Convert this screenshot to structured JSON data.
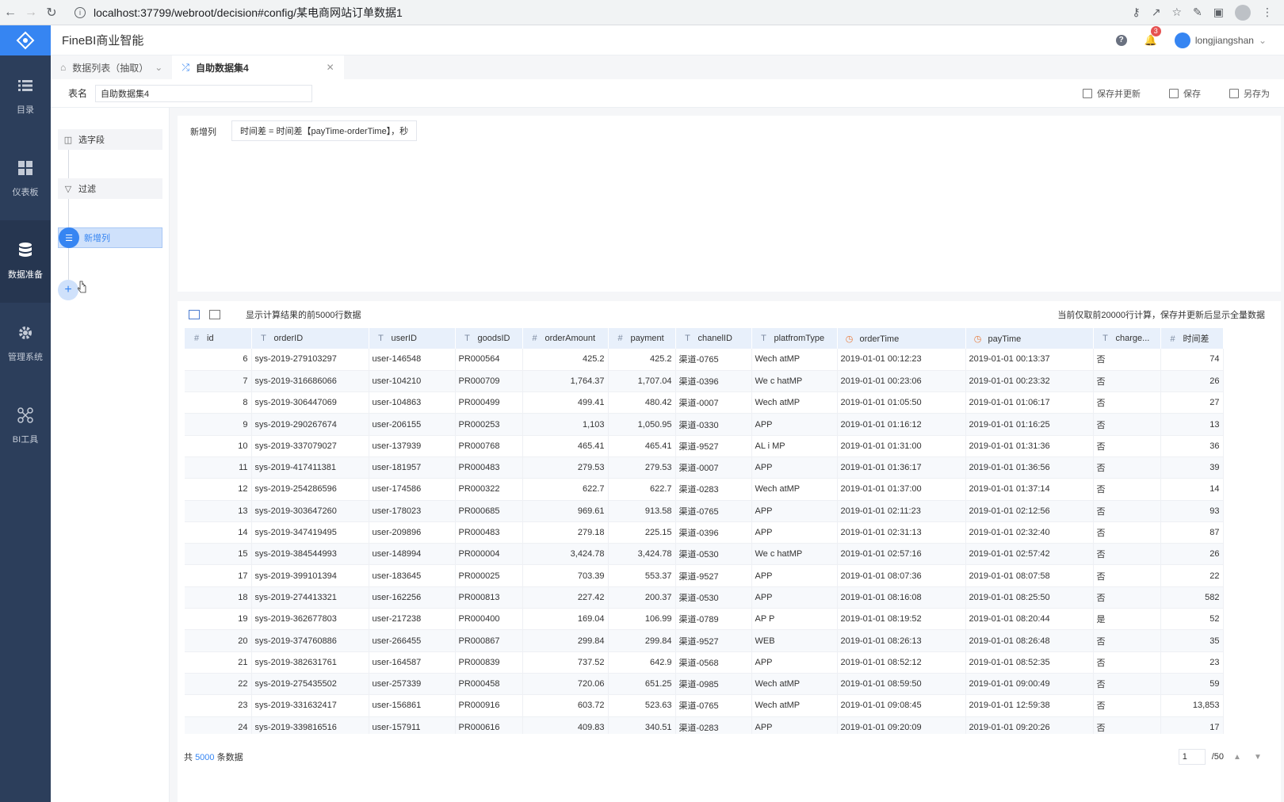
{
  "browser": {
    "url": "localhost:37799/webroot/decision#config/某电商网站订单数据1"
  },
  "sidebar": {
    "items": [
      {
        "label": "目录",
        "icon": "list-icon"
      },
      {
        "label": "仪表板",
        "icon": "dashboard-icon"
      },
      {
        "label": "数据准备",
        "icon": "database-icon",
        "active": true
      },
      {
        "label": "管理系统",
        "icon": "gear-icon"
      },
      {
        "label": "BI工具",
        "icon": "tools-icon"
      }
    ]
  },
  "header": {
    "title": "FineBI商业智能",
    "notification_count": "3",
    "username": "longjiangshan"
  },
  "tabs": [
    {
      "label": "数据列表（抽取）"
    },
    {
      "label": "自助数据集4",
      "active": true
    }
  ],
  "table_name": {
    "label": "表名",
    "value": "自助数据集4"
  },
  "actions": {
    "save_update": "保存并更新",
    "save": "保存",
    "save_as": "另存为"
  },
  "steps": [
    {
      "label": "选字段"
    },
    {
      "label": "过滤"
    },
    {
      "label": "新增列",
      "active": true
    }
  ],
  "config": {
    "label": "新增列",
    "formula": "时间差 = 时间差【payTime-orderTime】，秒"
  },
  "preview": {
    "tip": "显示计算结果的前5000行数据",
    "note": "当前仅取前20000行计算，保存并更新后显示全量数据",
    "columns": [
      {
        "type": "#",
        "name": "id"
      },
      {
        "type": "T",
        "name": "orderID"
      },
      {
        "type": "T",
        "name": "userID"
      },
      {
        "type": "T",
        "name": "goodsID"
      },
      {
        "type": "#",
        "name": "orderAmount"
      },
      {
        "type": "#",
        "name": "payment"
      },
      {
        "type": "T",
        "name": "chanelID"
      },
      {
        "type": "T",
        "name": "platfromType"
      },
      {
        "type": "clock",
        "name": "orderTime"
      },
      {
        "type": "clock",
        "name": "payTime"
      },
      {
        "type": "T",
        "name": "charge..."
      },
      {
        "type": "#",
        "name": "时间差"
      }
    ],
    "rows": [
      [
        "6",
        "sys-2019-279103297",
        "user-146548",
        "PR000564",
        "425.2",
        "425.2",
        "渠道-0765",
        "Wech atMP",
        "2019-01-01 00:12:23",
        "2019-01-01 00:13:37",
        "否",
        "74"
      ],
      [
        "7",
        "sys-2019-316686066",
        "user-104210",
        "PR000709",
        "1,764.37",
        "1,707.04",
        "渠道-0396",
        "We c hatMP",
        "2019-01-01 00:23:06",
        "2019-01-01 00:23:32",
        "否",
        "26"
      ],
      [
        "8",
        "sys-2019-306447069",
        "user-104863",
        "PR000499",
        "499.41",
        "480.42",
        "渠道-0007",
        "Wech atMP",
        "2019-01-01 01:05:50",
        "2019-01-01 01:06:17",
        "否",
        "27"
      ],
      [
        "9",
        "sys-2019-290267674",
        "user-206155",
        "PR000253",
        "1,103",
        "1,050.95",
        "渠道-0330",
        "APP",
        "2019-01-01 01:16:12",
        "2019-01-01 01:16:25",
        "否",
        "13"
      ],
      [
        "10",
        "sys-2019-337079027",
        "user-137939",
        "PR000768",
        "465.41",
        "465.41",
        "渠道-9527",
        "AL i MP",
        "2019-01-01 01:31:00",
        "2019-01-01 01:31:36",
        "否",
        "36"
      ],
      [
        "11",
        "sys-2019-417411381",
        "user-181957",
        "PR000483",
        "279.53",
        "279.53",
        "渠道-0007",
        "APP",
        "2019-01-01 01:36:17",
        "2019-01-01 01:36:56",
        "否",
        "39"
      ],
      [
        "12",
        "sys-2019-254286596",
        "user-174586",
        "PR000322",
        "622.7",
        "622.7",
        "渠道-0283",
        "Wech atMP",
        "2019-01-01 01:37:00",
        "2019-01-01 01:37:14",
        "否",
        "14"
      ],
      [
        "13",
        "sys-2019-303647260",
        "user-178023",
        "PR000685",
        "969.61",
        "913.58",
        "渠道-0765",
        "APP",
        "2019-01-01 02:11:23",
        "2019-01-01 02:12:56",
        "否",
        "93"
      ],
      [
        "14",
        "sys-2019-347419495",
        "user-209896",
        "PR000483",
        "279.18",
        "225.15",
        "渠道-0396",
        "APP",
        "2019-01-01 02:31:13",
        "2019-01-01 02:32:40",
        "否",
        "87"
      ],
      [
        "15",
        "sys-2019-384544993",
        "user-148994",
        "PR000004",
        "3,424.78",
        "3,424.78",
        "渠道-0530",
        "We c hatMP",
        "2019-01-01 02:57:16",
        "2019-01-01 02:57:42",
        "否",
        "26"
      ],
      [
        "17",
        "sys-2019-399101394",
        "user-183645",
        "PR000025",
        "703.39",
        "553.37",
        "渠道-9527",
        "APP",
        "2019-01-01 08:07:36",
        "2019-01-01 08:07:58",
        "否",
        "22"
      ],
      [
        "18",
        "sys-2019-274413321",
        "user-162256",
        "PR000813",
        "227.42",
        "200.37",
        "渠道-0530",
        "APP",
        "2019-01-01 08:16:08",
        "2019-01-01 08:25:50",
        "否",
        "582"
      ],
      [
        "19",
        "sys-2019-362677803",
        "user-217238",
        "PR000400",
        "169.04",
        "106.99",
        "渠道-0789",
        "AP P",
        "2019-01-01 08:19:52",
        "2019-01-01 08:20:44",
        "是",
        "52"
      ],
      [
        "20",
        "sys-2019-374760886",
        "user-266455",
        "PR000867",
        "299.84",
        "299.84",
        "渠道-9527",
        "WEB",
        "2019-01-01 08:26:13",
        "2019-01-01 08:26:48",
        "否",
        "35"
      ],
      [
        "21",
        "sys-2019-382631761",
        "user-164587",
        "PR000839",
        "737.52",
        "642.9",
        "渠道-0568",
        "APP",
        "2019-01-01 08:52:12",
        "2019-01-01 08:52:35",
        "否",
        "23"
      ],
      [
        "22",
        "sys-2019-275435502",
        "user-257339",
        "PR000458",
        "720.06",
        "651.25",
        "渠道-0985",
        "Wech atMP",
        "2019-01-01 08:59:50",
        "2019-01-01 09:00:49",
        "否",
        "59"
      ],
      [
        "23",
        "sys-2019-331632417",
        "user-156861",
        "PR000916",
        "603.72",
        "523.63",
        "渠道-0765",
        "Wech atMP",
        "2019-01-01 09:08:45",
        "2019-01-01 12:59:38",
        "否",
        "13,853"
      ],
      [
        "24",
        "sys-2019-339816516",
        "user-157911",
        "PR000616",
        "409.83",
        "340.51",
        "渠道-0283",
        "APP",
        "2019-01-01 09:20:09",
        "2019-01-01 09:20:26",
        "否",
        "17"
      ]
    ]
  },
  "footer": {
    "total_prefix": "共",
    "total_count": "5000",
    "total_suffix": "条数据",
    "page": "1",
    "page_total": "/50"
  }
}
